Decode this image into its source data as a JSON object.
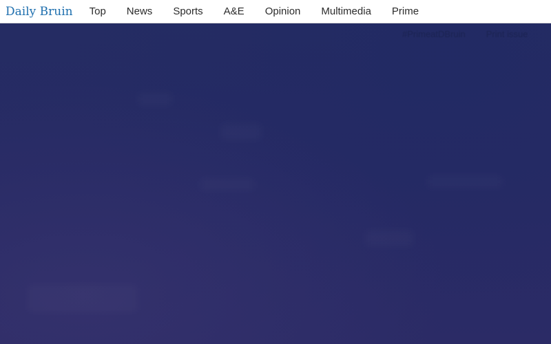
{
  "header": {
    "brand": "Daily Bruin",
    "nav": [
      {
        "label": "Top"
      },
      {
        "label": "News"
      },
      {
        "label": "Sports"
      },
      {
        "label": "A&E"
      },
      {
        "label": "Opinion"
      },
      {
        "label": "Multimedia"
      },
      {
        "label": "Prime"
      }
    ]
  },
  "hero": {
    "links": [
      {
        "label": "#PrimeatDBruin"
      },
      {
        "label": "Print issue"
      }
    ]
  },
  "colors": {
    "brand": "#1e6fae",
    "nav_text": "#2b2b2b",
    "hero_background": "#262a64"
  }
}
